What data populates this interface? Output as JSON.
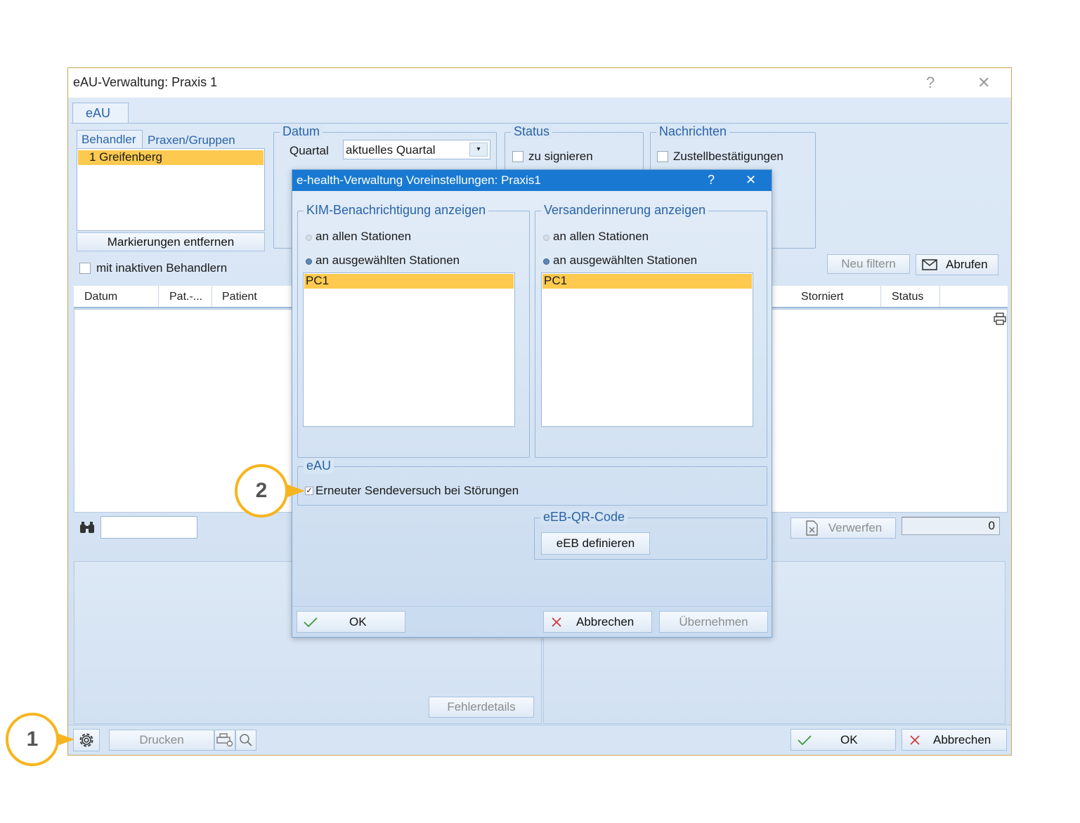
{
  "window": {
    "title": "eAU-Verwaltung: Praxis 1",
    "help_icon": "?",
    "close_icon": "✕"
  },
  "tabs": {
    "main": "eAU"
  },
  "behandler": {
    "tab_behandler": "Behandler",
    "tab_praxen": "Praxen/Gruppen",
    "items": [
      "1 Greifenberg"
    ],
    "clear_button": "Markierungen entfernen",
    "inactive_checkbox": "mit inaktiven Behandlern"
  },
  "datum": {
    "legend": "Datum",
    "quartal_label": "Quartal",
    "quartal_value": "aktuelles Quartal"
  },
  "status": {
    "legend": "Status",
    "zu_signieren": "zu signieren"
  },
  "nachrichten": {
    "legend": "Nachrichten",
    "zustellbestaetigungen": "Zustellbestätigungen"
  },
  "actions": {
    "neu_filtern": "Neu filtern",
    "abrufen": "Abrufen"
  },
  "table": {
    "columns_left": [
      "Datum",
      "Pat.-...",
      "Patient"
    ],
    "columns_right": [
      "Storniert",
      "Status"
    ]
  },
  "lower": {
    "verwerfen": "Verwerfen",
    "counter": "0",
    "fehlerdetails": "Fehlerdetails"
  },
  "footer": {
    "drucken": "Drucken",
    "ok": "OK",
    "abbrechen": "Abbrechen"
  },
  "dialog": {
    "title": "e-health-Verwaltung Voreinstellungen: Praxis1",
    "help_icon": "?",
    "close_icon": "✕",
    "kim": {
      "legend": "KIM-Benachrichtigung anzeigen",
      "option_all": "an allen Stationen",
      "option_selected": "an ausgewählten Stationen",
      "stations": [
        "PC1"
      ]
    },
    "versand": {
      "legend": "Versanderinnerung anzeigen",
      "option_all": "an allen Stationen",
      "option_selected": "an ausgewählten Stationen",
      "stations": [
        "PC1"
      ]
    },
    "eau": {
      "legend": "eAU",
      "retry_checkbox": "Erneuter Sendeversuch bei Störungen",
      "retry_checked": true
    },
    "eeb": {
      "legend": "eEB-QR-Code",
      "define_button": "eEB definieren"
    },
    "buttons": {
      "ok": "OK",
      "abbrechen": "Abbrechen",
      "uebernehmen": "Übernehmen"
    }
  },
  "callouts": {
    "one": "1",
    "two": "2"
  },
  "colors": {
    "accent": "#1979d2",
    "selection": "#fdca4f",
    "callout": "#f6b51f"
  }
}
